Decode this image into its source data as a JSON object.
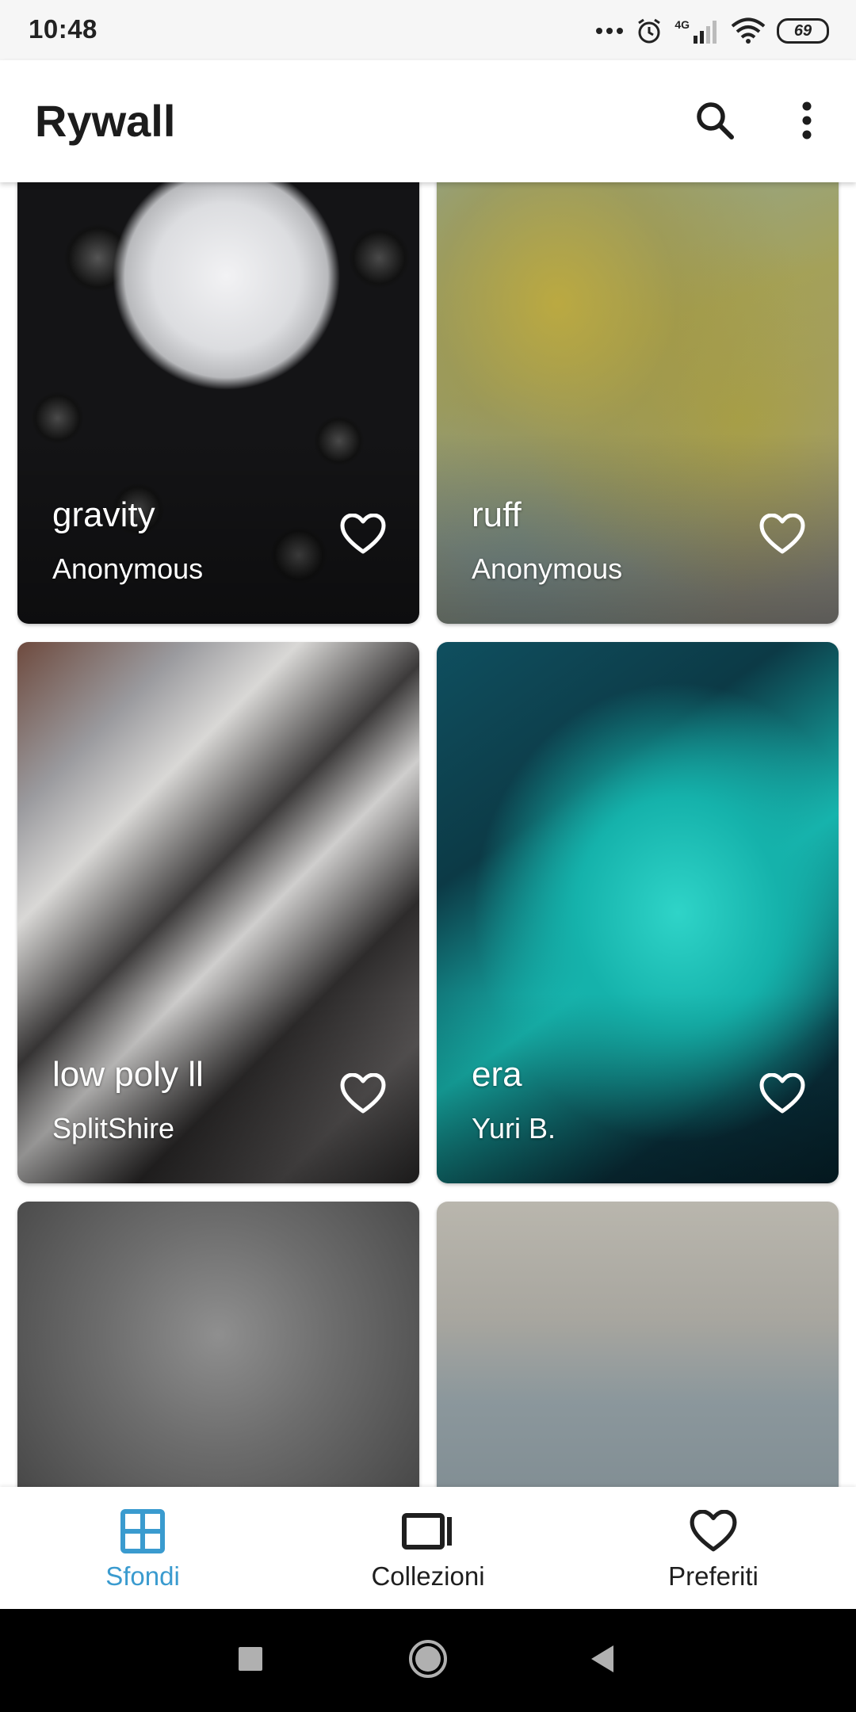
{
  "status_bar": {
    "time": "10:48",
    "network": "4G",
    "battery": "69",
    "icons": [
      "more-dots-icon",
      "alarm-icon",
      "signal-icon",
      "wifi-icon",
      "battery-icon"
    ]
  },
  "app_bar": {
    "title": "Rywall",
    "actions": [
      "search-icon",
      "more-vert-icon"
    ]
  },
  "wallpapers": [
    {
      "title": "gravity",
      "author": "Anonymous",
      "favorite_icon": "heart-outline-icon"
    },
    {
      "title": "ruff",
      "author": "Anonymous",
      "favorite_icon": "heart-outline-icon"
    },
    {
      "title": "low poly ll",
      "author": "SplitShire",
      "favorite_icon": "heart-outline-icon"
    },
    {
      "title": "era",
      "author": "Yuri B.",
      "favorite_icon": "heart-outline-icon"
    },
    {
      "title": "",
      "author": ""
    },
    {
      "title": "",
      "author": ""
    }
  ],
  "bottom_nav": {
    "items": [
      {
        "label": "Sfondi",
        "icon": "grid-icon",
        "active": true
      },
      {
        "label": "Collezioni",
        "icon": "collections-icon",
        "active": false
      },
      {
        "label": "Preferiti",
        "icon": "heart-icon",
        "active": false
      }
    ]
  },
  "system_nav": [
    "recents-square-icon",
    "home-circle-icon",
    "back-triangle-icon"
  ],
  "colors": {
    "accent": "#3a9bcf",
    "text": "#1f1f1f",
    "status_bar_bg": "#f6f6f6",
    "system_nav_bg": "#000000"
  }
}
